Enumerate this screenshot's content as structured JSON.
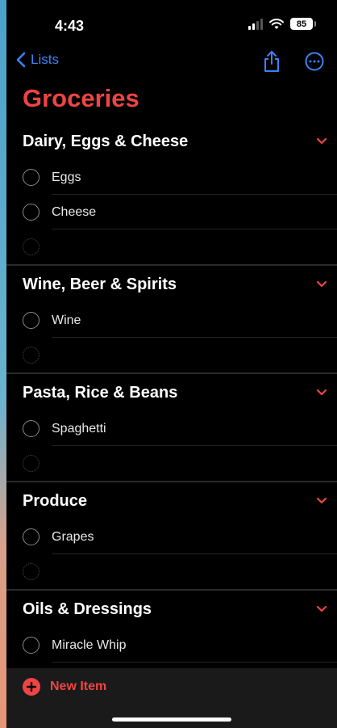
{
  "status_bar": {
    "time": "4:43",
    "battery": "85",
    "icons": [
      "signal-icon",
      "wifi-icon",
      "battery-icon"
    ]
  },
  "nav": {
    "back_label": "Lists",
    "back_icon": "chevron-left-icon",
    "actions": [
      "share-icon",
      "more-icon"
    ]
  },
  "title": "Groceries",
  "sections": [
    {
      "title": "Dairy, Eggs & Cheese",
      "items": [
        "Eggs",
        "Cheese"
      ]
    },
    {
      "title": "Wine, Beer & Spirits",
      "items": [
        "Wine"
      ]
    },
    {
      "title": "Pasta, Rice & Beans",
      "items": [
        "Spaghetti"
      ]
    },
    {
      "title": "Produce",
      "items": [
        "Grapes"
      ]
    },
    {
      "title": "Oils & Dressings",
      "items": [
        "Miracle Whip"
      ]
    }
  ],
  "footer": {
    "new_item_label": "New Item"
  },
  "colors": {
    "accent": "#ef4444",
    "link": "#3b82f6",
    "background": "#000000"
  }
}
